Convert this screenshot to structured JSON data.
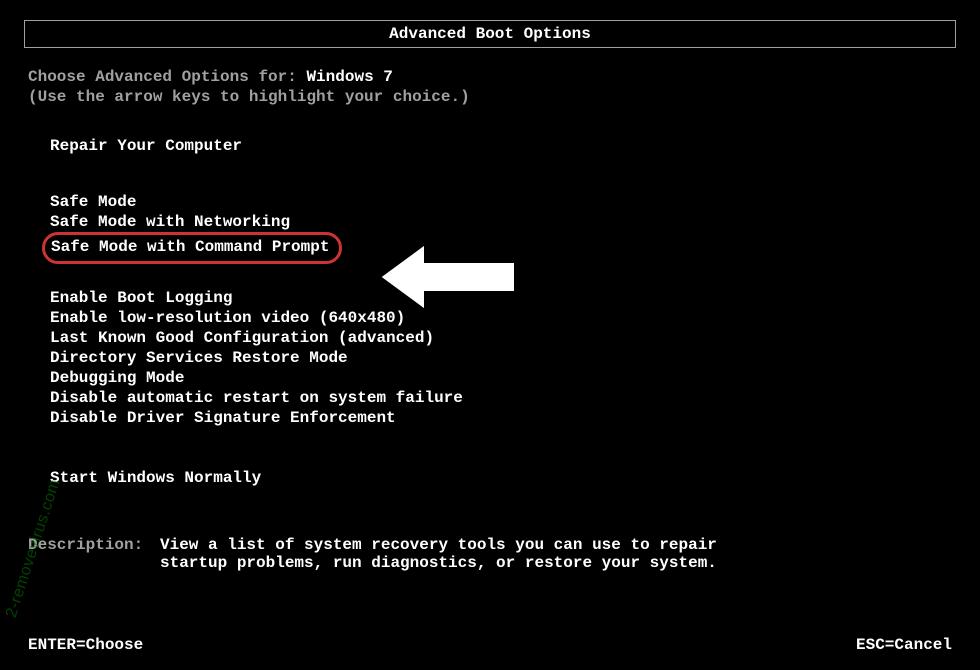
{
  "header": {
    "title": "Advanced Boot Options"
  },
  "prompt": {
    "prefix": "Choose Advanced Options for: ",
    "os": "Windows 7",
    "instruction": "(Use the arrow keys to highlight your choice.)"
  },
  "menu": {
    "repair": "Repair Your Computer",
    "safe_mode": "Safe Mode",
    "safe_mode_net": "Safe Mode with Networking",
    "safe_mode_cmd": "Safe Mode with Command Prompt",
    "boot_logging": "Enable Boot Logging",
    "low_res": "Enable low-resolution video (640x480)",
    "last_known": "Last Known Good Configuration (advanced)",
    "ds_restore": "Directory Services Restore Mode",
    "debugging": "Debugging Mode",
    "disable_restart": "Disable automatic restart on system failure",
    "disable_sig": "Disable Driver Signature Enforcement",
    "start_normal": "Start Windows Normally"
  },
  "description": {
    "label": "Description:",
    "text_line1": "View a list of system recovery tools you can use to repair",
    "text_line2": "startup problems, run diagnostics, or restore your system."
  },
  "footer": {
    "enter": "ENTER=Choose",
    "esc": "ESC=Cancel"
  },
  "watermark": "2-removevirus.com",
  "callout": {
    "highlight_color": "#c33"
  }
}
